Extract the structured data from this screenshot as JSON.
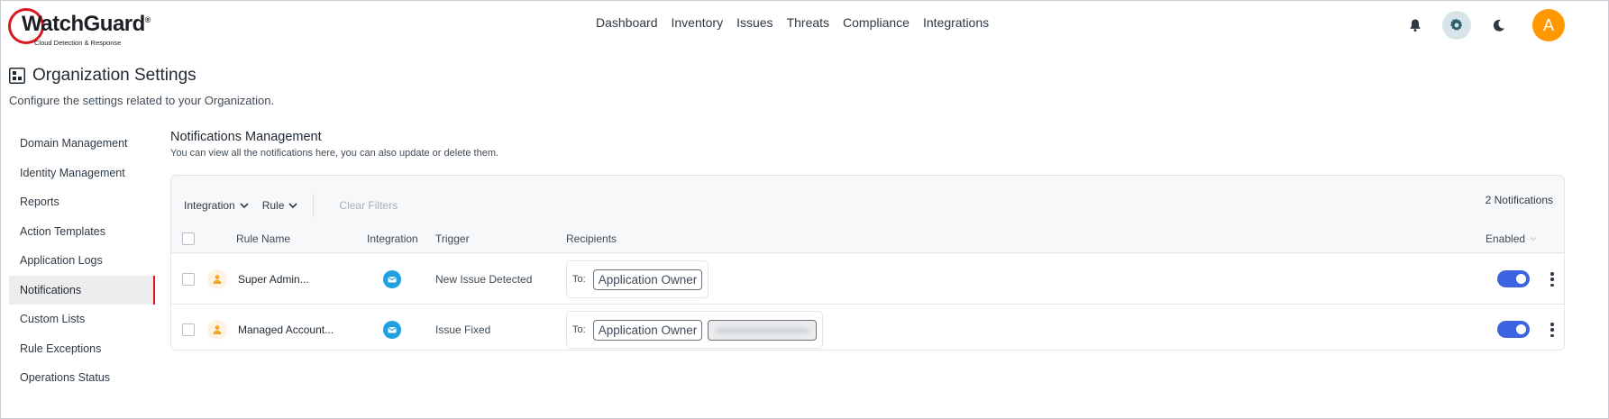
{
  "brand": {
    "name": "WatchGuard",
    "trademark": "®",
    "tagline": "Cloud Detection & Response"
  },
  "nav": {
    "items": [
      {
        "label": "Dashboard"
      },
      {
        "label": "Inventory"
      },
      {
        "label": "Issues"
      },
      {
        "label": "Threats"
      },
      {
        "label": "Compliance"
      },
      {
        "label": "Integrations"
      }
    ]
  },
  "header": {
    "icons": [
      "bell-icon",
      "gear-icon",
      "moon-icon"
    ],
    "avatar_initial": "A",
    "avatar_color": "#ff9800"
  },
  "page": {
    "title": "Organization Settings",
    "subtitle": "Configure the settings related to your Organization."
  },
  "sidebar": {
    "items": [
      {
        "label": "Domain Management"
      },
      {
        "label": "Identity Management"
      },
      {
        "label": "Reports"
      },
      {
        "label": "Action Templates"
      },
      {
        "label": "Application Logs"
      },
      {
        "label": "Notifications",
        "active": true
      },
      {
        "label": "Custom Lists"
      },
      {
        "label": "Rule Exceptions"
      },
      {
        "label": "Operations Status"
      }
    ]
  },
  "section": {
    "title": "Notifications Management",
    "subtitle": "You can view all the notifications here, you can also update or delete them."
  },
  "filters": {
    "integration": "Integration",
    "rule": "Rule",
    "clear": "Clear Filters",
    "count": "2 Notifications"
  },
  "table": {
    "columns": {
      "rule_name": "Rule Name",
      "integration": "Integration",
      "trigger": "Trigger",
      "recipients": "Recipients",
      "enabled": "Enabled"
    },
    "to_label": "To:",
    "rows": [
      {
        "rule_name": "Super Admin...",
        "integration_icon": "mail-icon",
        "trigger": "New Issue Detected",
        "recipients": [
          "Application Owner"
        ],
        "enabled": true
      },
      {
        "rule_name": "Managed Account...",
        "integration_icon": "mail-icon",
        "trigger": "Issue Fixed",
        "recipients": [
          "Application Owner"
        ],
        "has_redacted_recipient": true,
        "enabled": true
      }
    ]
  },
  "colors": {
    "accent": "#3d64e0",
    "active_indicator": "#d71920",
    "mail": "#1fa0e0"
  }
}
